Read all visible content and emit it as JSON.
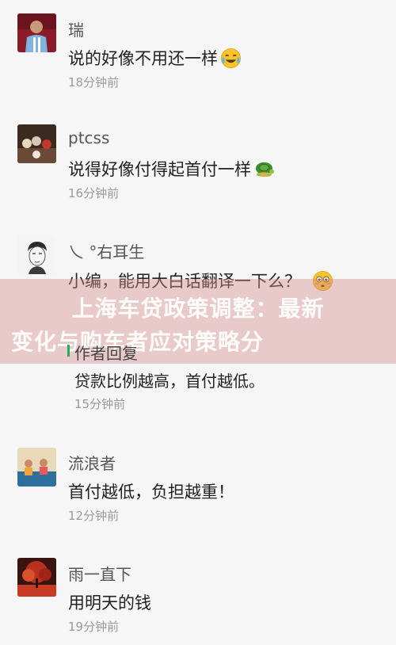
{
  "comments": [
    {
      "nickname": "瑞",
      "text": "说的好像不用还一样",
      "time": "18分钟前",
      "emoji": "crying-laughing-emoji"
    },
    {
      "nickname": "ptcss",
      "text": "说得好像付得起首付一样",
      "time": "16分钟前",
      "emoji": "turtle-emoji"
    },
    {
      "nickname": "乀 °右耳生",
      "text": "小编，能用大白话翻译一下么？",
      "time": "",
      "emoji": "flushed-face-emoji"
    },
    {
      "nickname": "作者回复",
      "text": "贷款比例越高，首付越低。",
      "time": "15分钟前"
    },
    {
      "nickname": "流浪者",
      "text": "首付越低，负担越重！",
      "time": "12分钟前"
    },
    {
      "nickname": "雨一直下",
      "text": "用明天的钱",
      "time": "19分钟前"
    }
  ],
  "overlay": {
    "line1": "上海车贷政策调整：最新",
    "line2": "变化与购车者应对策略分"
  },
  "colors": {
    "background": "#f6f6f6",
    "banner": "#d78c8c",
    "author_mark": "#21b04b"
  }
}
